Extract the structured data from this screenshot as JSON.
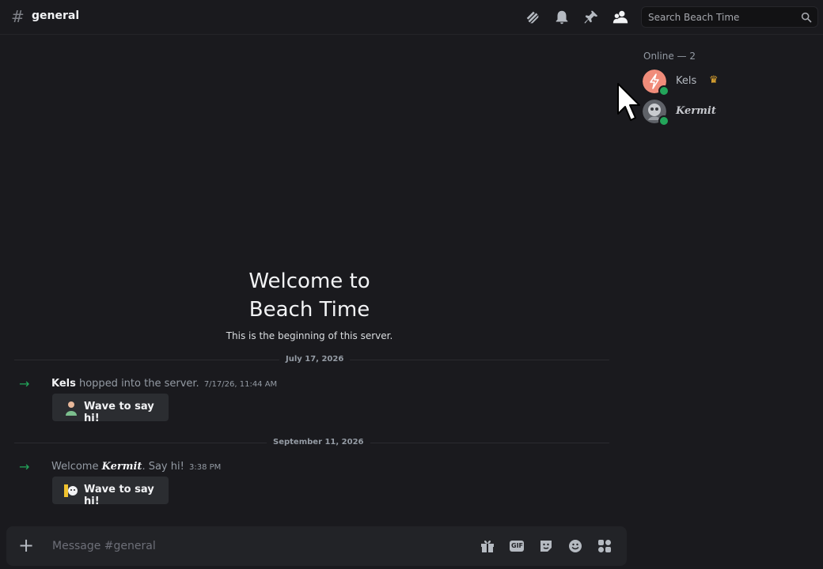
{
  "header": {
    "hash": "#",
    "channel": "general",
    "icons": [
      "threads-icon",
      "bell-icon",
      "pin-icon",
      "members-icon"
    ],
    "search_placeholder": "Search Beach Time"
  },
  "members": {
    "heading": "Online — 2",
    "list": [
      {
        "name": "Kels",
        "badge": "♛",
        "status": "online",
        "avatar_color": "#f08c7a"
      },
      {
        "name": "Kermit",
        "status": "online",
        "avatar_color": "#6b6e74"
      }
    ]
  },
  "welcome": {
    "title_line1": "Welcome to",
    "title_line2": "Beach Time",
    "subtitle": "This is the beginning of this server."
  },
  "messages": [
    {
      "date": "July 17, 2026",
      "user": "Kels",
      "text": " hopped into the server.",
      "time": "7/17/26, 11:44 AM",
      "button": "Wave to say hi!"
    },
    {
      "date": "September 11, 2026",
      "prefix": "Welcome ",
      "user": "Kermit",
      "text": ". Say hi!",
      "time": "3:38 PM",
      "button": "Wave to say hi!"
    }
  ],
  "composer": {
    "placeholder": "Message #general",
    "icons": [
      "gift-icon",
      "gif-icon",
      "sticker-icon",
      "emoji-icon",
      "apps-icon"
    ],
    "gif_text": "GIF"
  },
  "colors": {
    "background": "#1a1a1e",
    "online": "#23a55a",
    "accent_green": "#23a55a"
  }
}
